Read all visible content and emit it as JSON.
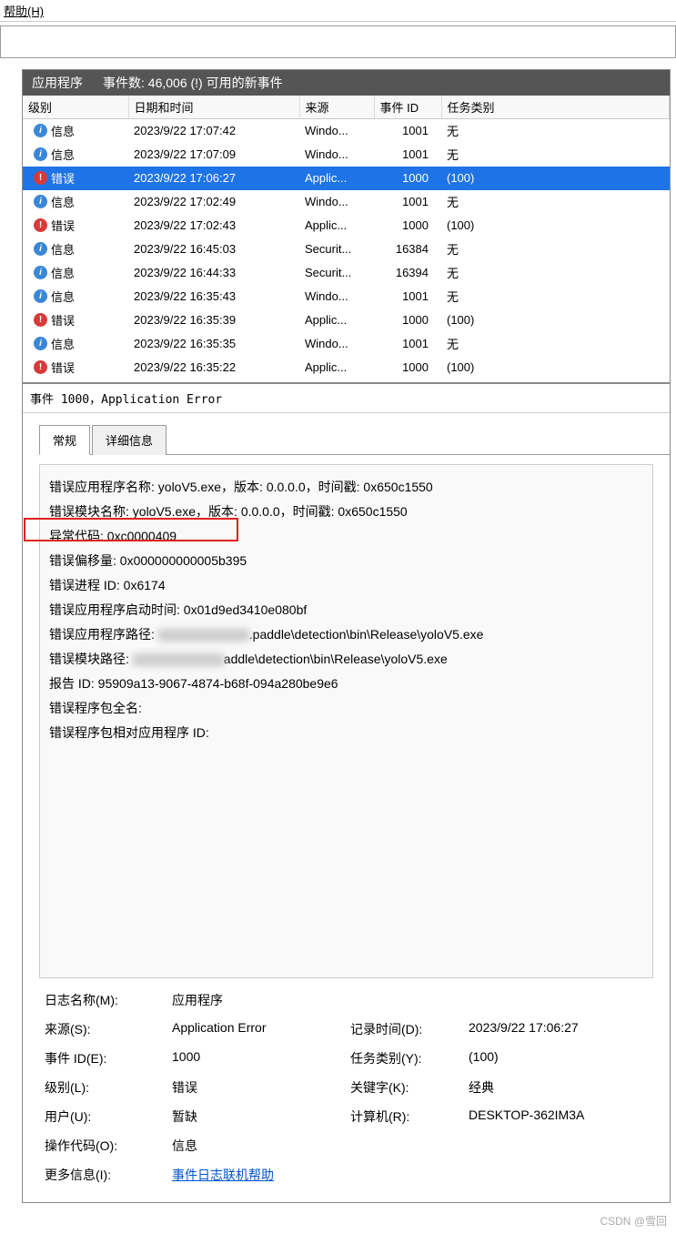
{
  "menubar": {
    "help": "帮助(H)"
  },
  "section": {
    "title": "应用程序",
    "count_label": "事件数: 46,006 (!) 可用的新事件"
  },
  "columns": {
    "level": "级别",
    "datetime": "日期和时间",
    "source": "来源",
    "event_id": "事件 ID",
    "category": "任务类别"
  },
  "rows": [
    {
      "type": "info",
      "level": "信息",
      "dt": "2023/9/22 17:07:42",
      "src": "Windo...",
      "id": "1001",
      "cat": "无"
    },
    {
      "type": "info",
      "level": "信息",
      "dt": "2023/9/22 17:07:09",
      "src": "Windo...",
      "id": "1001",
      "cat": "无"
    },
    {
      "type": "error",
      "level": "错误",
      "dt": "2023/9/22 17:06:27",
      "src": "Applic...",
      "id": "1000",
      "cat": "(100)",
      "selected": true
    },
    {
      "type": "info",
      "level": "信息",
      "dt": "2023/9/22 17:02:49",
      "src": "Windo...",
      "id": "1001",
      "cat": "无"
    },
    {
      "type": "error",
      "level": "错误",
      "dt": "2023/9/22 17:02:43",
      "src": "Applic...",
      "id": "1000",
      "cat": "(100)"
    },
    {
      "type": "info",
      "level": "信息",
      "dt": "2023/9/22 16:45:03",
      "src": "Securit...",
      "id": "16384",
      "cat": "无"
    },
    {
      "type": "info",
      "level": "信息",
      "dt": "2023/9/22 16:44:33",
      "src": "Securit...",
      "id": "16394",
      "cat": "无"
    },
    {
      "type": "info",
      "level": "信息",
      "dt": "2023/9/22 16:35:43",
      "src": "Windo...",
      "id": "1001",
      "cat": "无"
    },
    {
      "type": "error",
      "level": "错误",
      "dt": "2023/9/22 16:35:39",
      "src": "Applic...",
      "id": "1000",
      "cat": "(100)"
    },
    {
      "type": "info",
      "level": "信息",
      "dt": "2023/9/22 16:35:35",
      "src": "Windo...",
      "id": "1001",
      "cat": "无"
    },
    {
      "type": "error",
      "level": "错误",
      "dt": "2023/9/22 16:35:22",
      "src": "Applic...",
      "id": "1000",
      "cat": "(100)"
    }
  ],
  "detail_header": "事件 1000，Application Error",
  "tabs": {
    "general": "常规",
    "details": "详细信息"
  },
  "detail_lines": {
    "l1": "错误应用程序名称: yoloV5.exe，版本: 0.0.0.0，时间戳: 0x650c1550",
    "l2": "错误模块名称: yoloV5.exe，版本: 0.0.0.0，时间戳: 0x650c1550",
    "l3": "异常代码: 0xc0000409",
    "l4": "错误偏移量: 0x000000000005b395",
    "l5": "错误进程 ID: 0x6174",
    "l6": "错误应用程序启动时间: 0x01d9ed3410e080bf",
    "l7a": "错误应用程序路径: ",
    "l7b": ".paddle\\detection\\bin\\Release\\yoloV5.exe",
    "l8a": "错误模块路径: ",
    "l8b": "addle\\detection\\bin\\Release\\yoloV5.exe",
    "l9": "报告 ID: 95909a13-9067-4874-b68f-094a280be9e6",
    "l10": "错误程序包全名:",
    "l11": "错误程序包相对应用程序 ID:"
  },
  "props": {
    "log_name_l": "日志名称(M):",
    "log_name_v": "应用程序",
    "source_l": "来源(S):",
    "source_v": "Application Error",
    "logged_l": "记录时间(D):",
    "logged_v": "2023/9/22 17:06:27",
    "event_id_l": "事件 ID(E):",
    "event_id_v": "1000",
    "category_l": "任务类别(Y):",
    "category_v": "(100)",
    "level_l": "级别(L):",
    "level_v": "错误",
    "keywords_l": "关键字(K):",
    "keywords_v": "经典",
    "user_l": "用户(U):",
    "user_v": "暂缺",
    "computer_l": "计算机(R):",
    "computer_v": "DESKTOP-362IM3A",
    "opcode_l": "操作代码(O):",
    "opcode_v": "信息",
    "more_l": "更多信息(I):",
    "more_v": "事件日志联机帮助"
  },
  "watermark": "CSDN @雪回"
}
